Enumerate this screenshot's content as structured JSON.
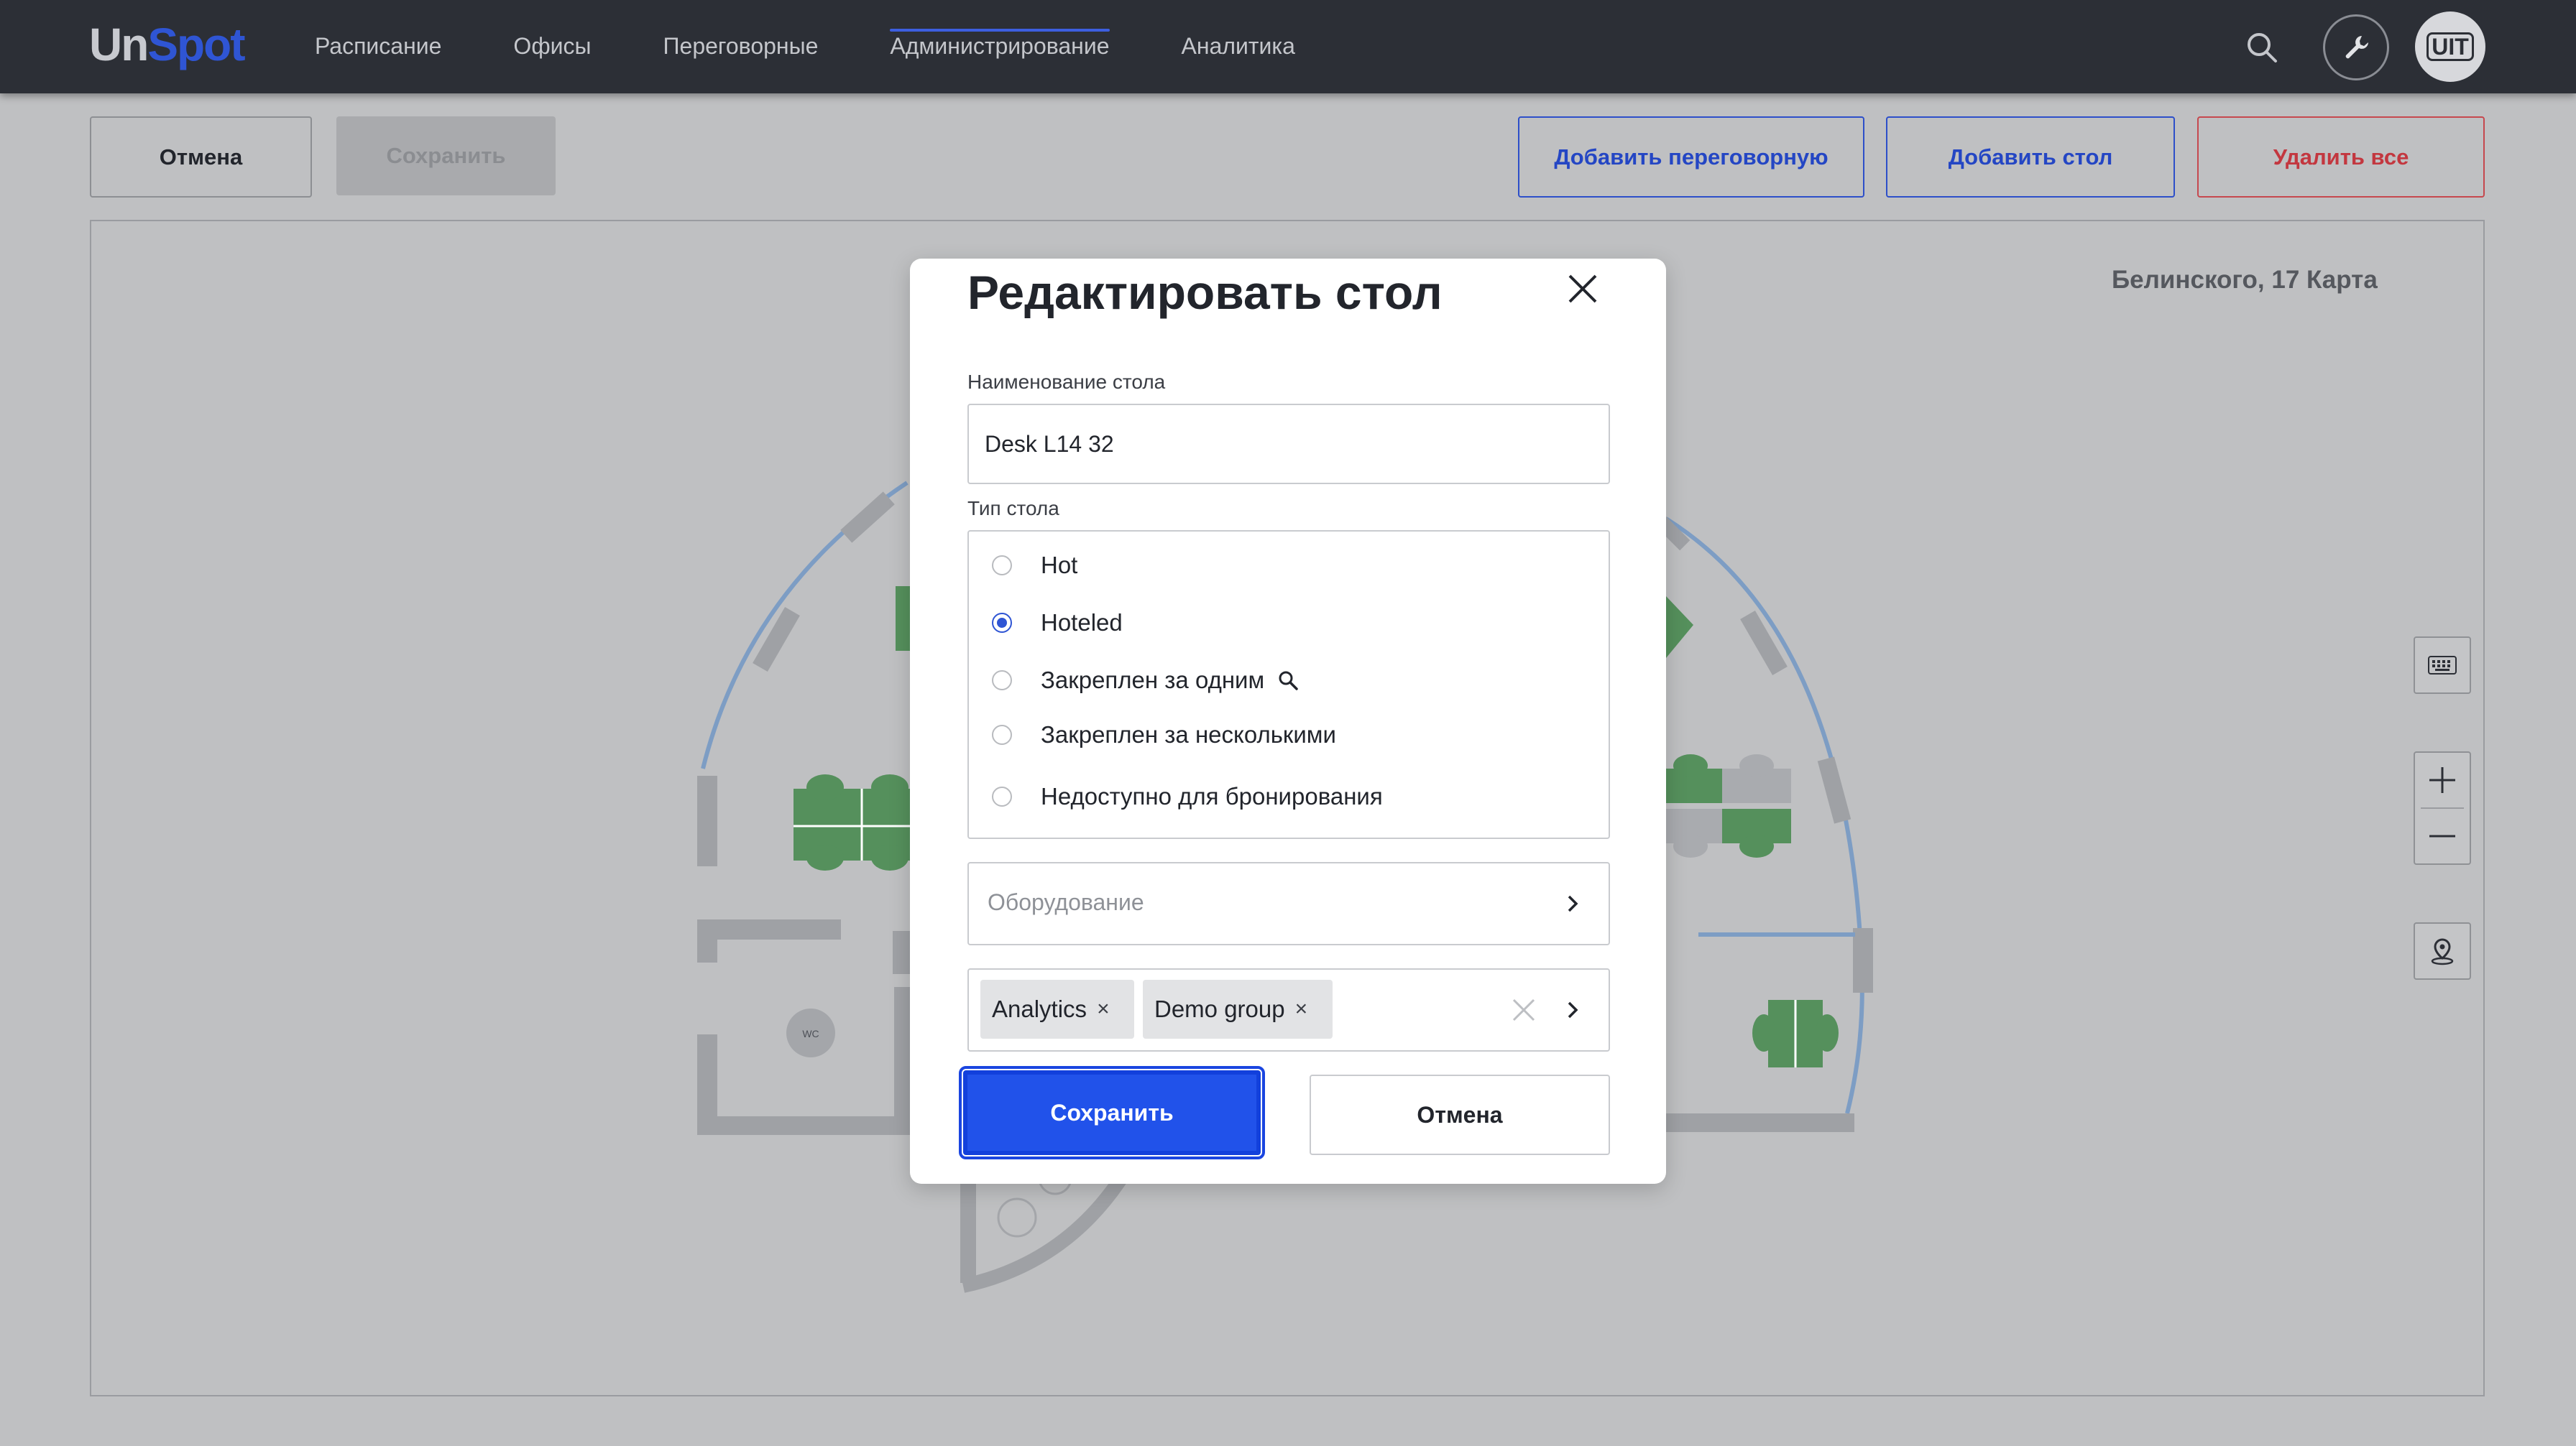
{
  "app": {
    "logo_part1": "Un",
    "logo_part2": "Spot",
    "accent_color": "#2f55d4"
  },
  "nav": {
    "items": [
      {
        "label": "Расписание",
        "active": false
      },
      {
        "label": "Офисы",
        "active": false
      },
      {
        "label": "Переговорные",
        "active": false
      },
      {
        "label": "Администрирование",
        "active": true
      },
      {
        "label": "Аналитика",
        "active": false
      }
    ],
    "icons": [
      "search-icon",
      "tools-icon"
    ],
    "avatar_initials": "UIT"
  },
  "toolbar": {
    "cancel_label": "Отмена",
    "save_label": "Сохранить",
    "add_room_label": "Добавить переговорную",
    "add_desk_label": "Добавить стол",
    "delete_all_label": "Удалить все"
  },
  "map": {
    "title": "Белинского, 17 Карта",
    "wc_label": "WC",
    "controls": [
      "keyboard-icon",
      "zoom-in-icon",
      "zoom-out-icon",
      "locate-icon"
    ]
  },
  "modal": {
    "title": "Редактировать стол",
    "name_label": "Наименование стола",
    "name_value": "Desk L14 32",
    "type_label": "Тип стола",
    "types": [
      {
        "label": "Hot",
        "checked": false
      },
      {
        "label": "Hoteled",
        "checked": true
      },
      {
        "label": "Закреплен за одним",
        "checked": false
      },
      {
        "label": "Закреплен за несколькими",
        "checked": false
      },
      {
        "label": "Недоступно для бронирования",
        "checked": false
      }
    ],
    "equipment_placeholder": "Оборудование",
    "groups": [
      {
        "label": "Analytics"
      },
      {
        "label": "Demo group"
      }
    ],
    "tag_remove_glyph": "×",
    "save_label": "Сохранить",
    "cancel_label": "Отмена"
  }
}
